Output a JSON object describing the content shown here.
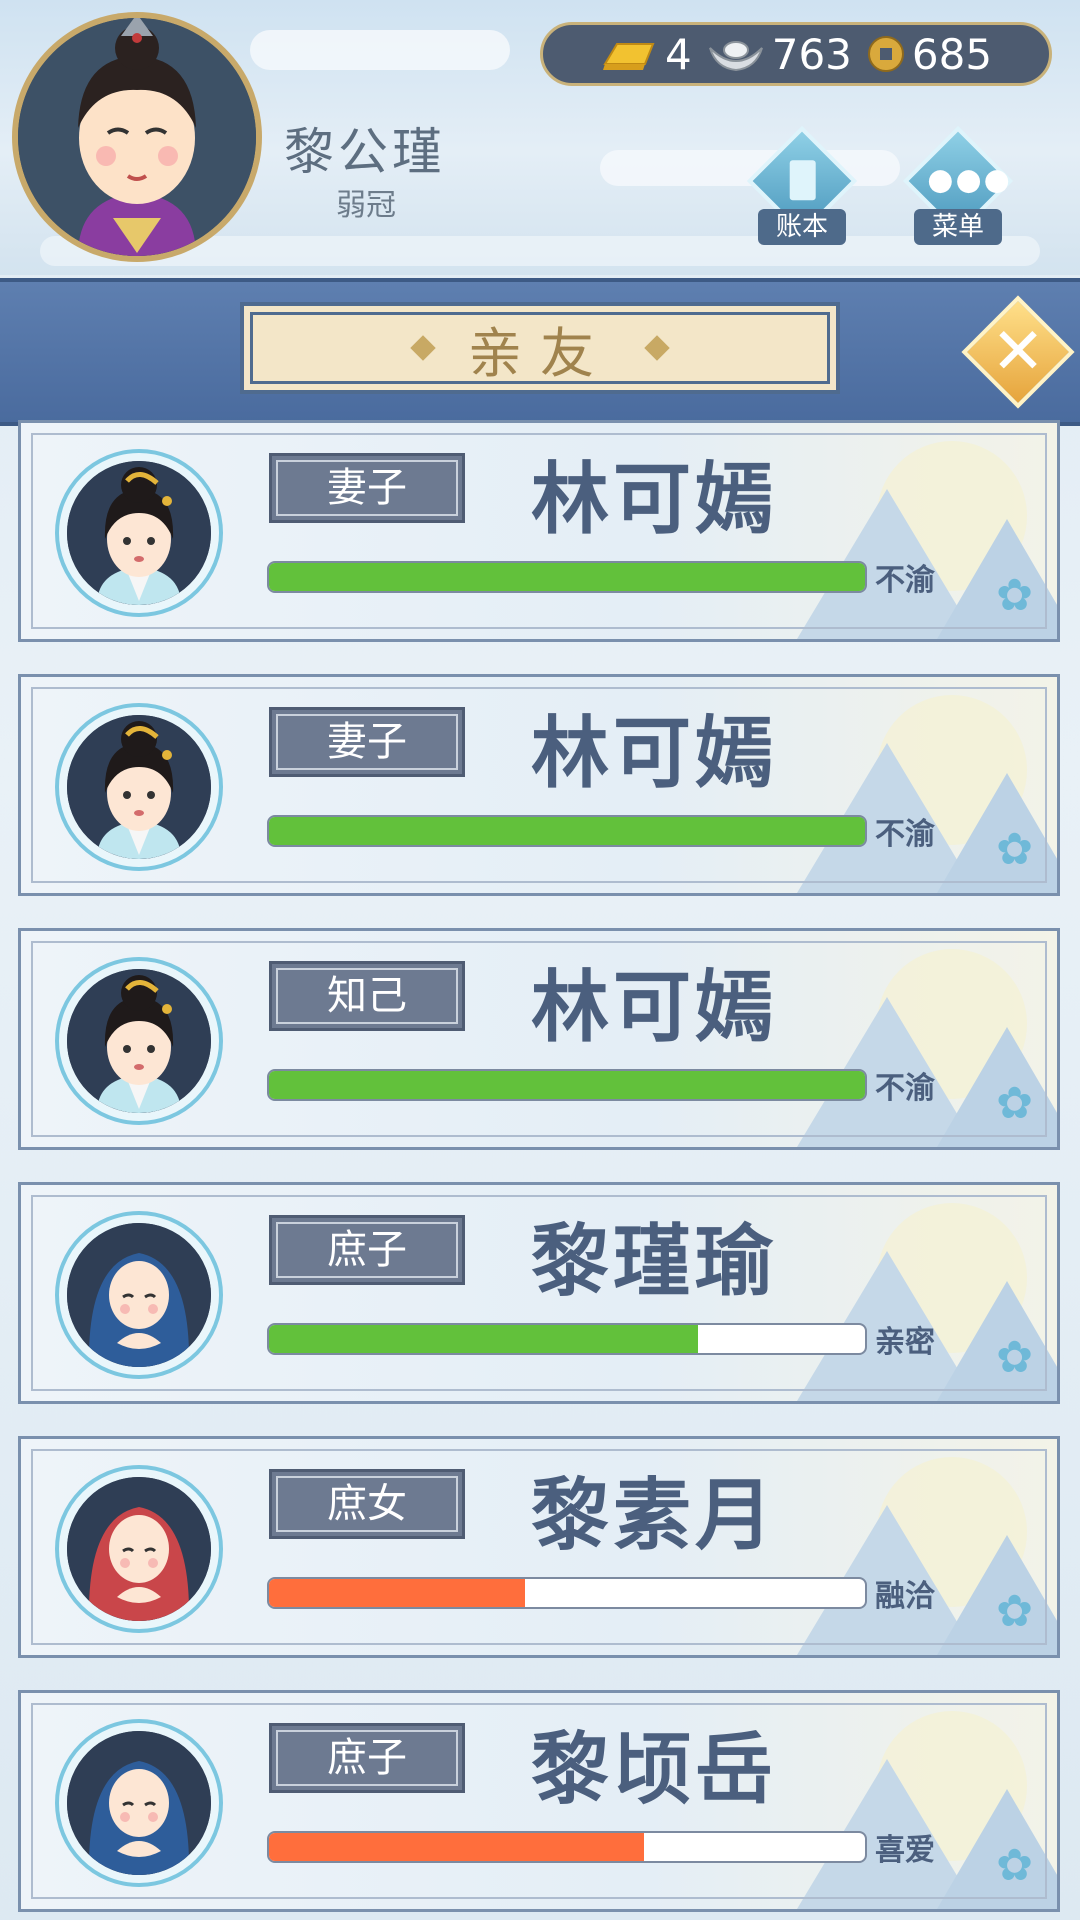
{
  "player": {
    "name": "黎公瑾",
    "title": "弱冠"
  },
  "currency": {
    "gold": "4",
    "silver": "763",
    "coin": "685"
  },
  "header_buttons": {
    "ledger": "账本",
    "menu": "菜单"
  },
  "banner": {
    "title": "亲友",
    "close": "✕"
  },
  "colors": {
    "green": "#62c13b",
    "orange": "#ff6e3c"
  },
  "relatives": [
    {
      "role": "妻子",
      "name": "林可嫣",
      "status": "不渝",
      "affinity": 1.0,
      "bar_color": "#62c13b",
      "avatar": "wife-avatar"
    },
    {
      "role": "妻子",
      "name": "林可嫣",
      "status": "不渝",
      "affinity": 1.0,
      "bar_color": "#62c13b",
      "avatar": "wife-avatar"
    },
    {
      "role": "知己",
      "name": "林可嫣",
      "status": "不渝",
      "affinity": 1.0,
      "bar_color": "#62c13b",
      "avatar": "wife-avatar"
    },
    {
      "role": "庶子",
      "name": "黎瑾瑜",
      "status": "亲密",
      "affinity": 0.72,
      "bar_color": "#62c13b",
      "avatar": "son-avatar"
    },
    {
      "role": "庶女",
      "name": "黎素月",
      "status": "融洽",
      "affinity": 0.43,
      "bar_color": "#ff6e3c",
      "avatar": "daughter-avatar"
    },
    {
      "role": "庶子",
      "name": "黎顷岳",
      "status": "喜爱",
      "affinity": 0.63,
      "bar_color": "#ff6e3c",
      "avatar": "son-avatar"
    }
  ]
}
